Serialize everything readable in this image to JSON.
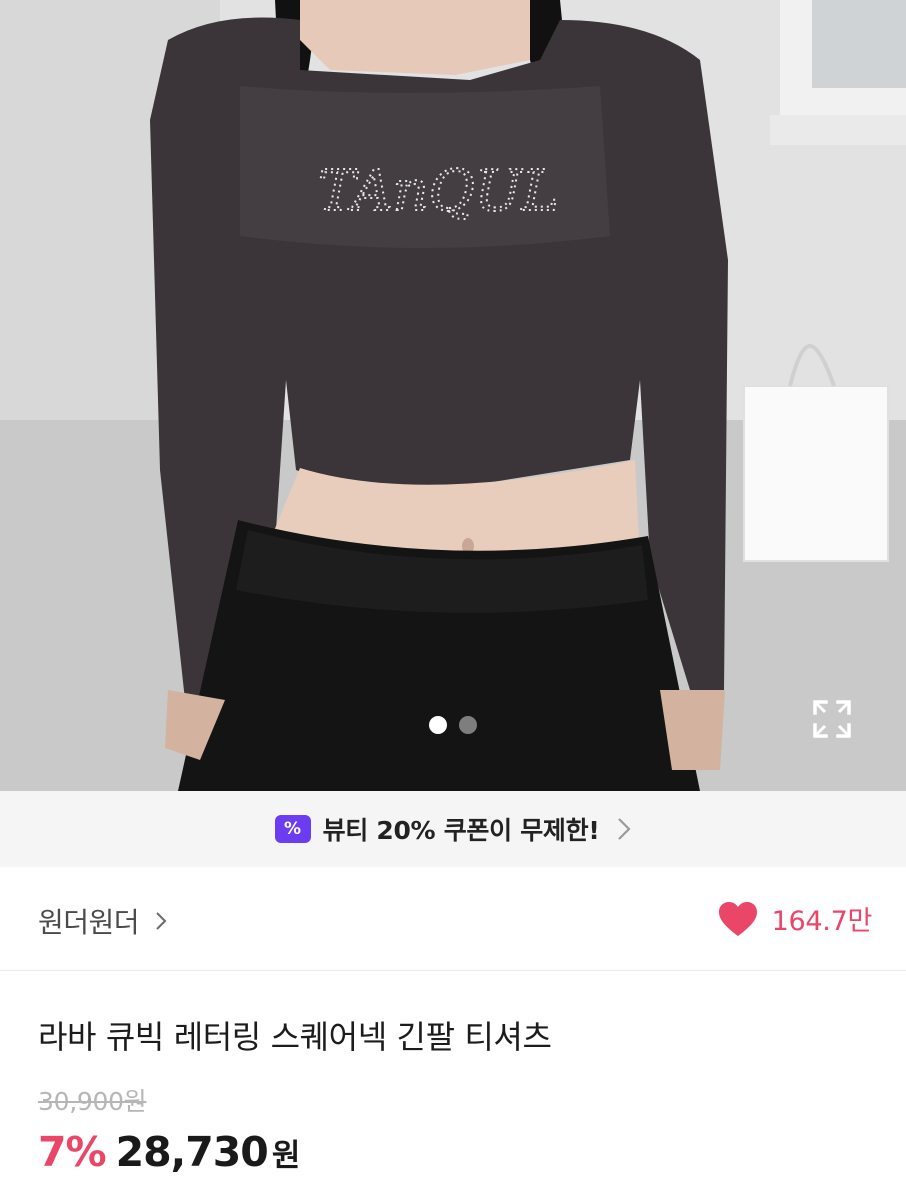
{
  "gallery": {
    "current_index": 0,
    "total_images": 2,
    "print_text": "TAnQUL"
  },
  "coupon": {
    "icon_label": "%",
    "text": "뷰티 20% 쿠폰이 무제한!"
  },
  "store": {
    "name": "원더원더"
  },
  "likes": {
    "count": "164.7만"
  },
  "product": {
    "title": "라바 큐빅 레터링 스퀘어넥 긴팔 티셔츠",
    "original_price": "30,900원",
    "discount": "7%",
    "sale_price": "28,730",
    "currency": "원"
  },
  "colors": {
    "accent_pink": "#ea4668",
    "coupon_purple": "#6c3cf0",
    "banner_bg": "#f5f5f6"
  },
  "icons": [
    "expand-icon",
    "coupon-percent-icon",
    "chevron-right-icon",
    "heart-icon"
  ]
}
